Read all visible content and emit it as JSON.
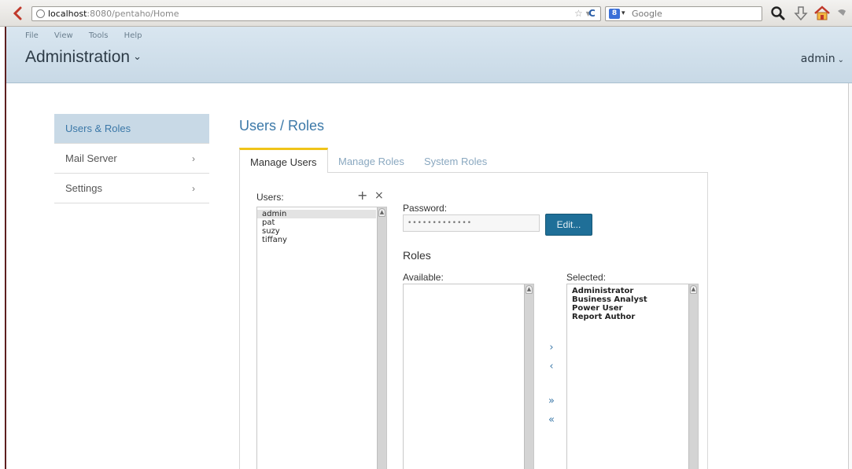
{
  "browser": {
    "url_host": "localhost",
    "url_rest": ":8080/pentaho/Home",
    "search_engine_badge": "8",
    "search_placeholder": "Google"
  },
  "header": {
    "menu": [
      "File",
      "View",
      "Tools",
      "Help"
    ],
    "perspective": "Administration",
    "user": "admin"
  },
  "sidebar": {
    "items": [
      {
        "label": "Users & Roles",
        "active": true
      },
      {
        "label": "Mail Server",
        "arrow": "›"
      },
      {
        "label": "Settings",
        "arrow": "›"
      }
    ]
  },
  "main": {
    "title": "Users / Roles",
    "tabs": [
      "Manage Users",
      "Manage Roles",
      "System Roles"
    ],
    "users_label": "Users:",
    "add_symbol": "+",
    "remove_symbol": "×",
    "users": [
      "admin",
      "pat",
      "suzy",
      "tiffany"
    ],
    "password_label": "Password:",
    "password_value": "•••••••••••••",
    "edit_label": "Edit...",
    "roles_heading": "Roles",
    "available_label": "Available:",
    "selected_label": "Selected:",
    "available_roles": [],
    "selected_roles": [
      "Administrator",
      "Business Analyst",
      "Power User",
      "Report Author"
    ],
    "move_buttons": {
      "add": "›",
      "remove": "‹",
      "add_all": "»",
      "remove_all": "«"
    }
  },
  "colors": {
    "accent": "#3b78a8",
    "header_bg": "#d9e6f0",
    "active_tab_border": "#f0c419",
    "button_bg": "#1f6f98"
  }
}
